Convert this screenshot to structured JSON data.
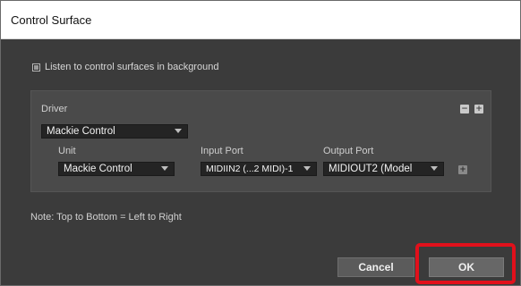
{
  "window": {
    "title": "Control Surface"
  },
  "background_option": {
    "label": "Listen to control surfaces in background",
    "checked": true
  },
  "panel": {
    "driver_label": "Driver",
    "driver_value": "Mackie Control",
    "columns": {
      "unit": "Unit",
      "input_port": "Input Port",
      "output_port": "Output Port"
    },
    "row": {
      "unit": "Mackie Control",
      "input_port": "MIDIIN2 (...2 MIDI)-1",
      "output_port": "MIDIOUT2 (Model"
    },
    "remove_symbol": "−",
    "add_symbol": "+"
  },
  "note": "Note: Top to Bottom = Left to Right",
  "buttons": {
    "cancel": "Cancel",
    "ok": "OK"
  },
  "colors": {
    "highlight": "#e1101b",
    "window_bg": "#3b3b3b",
    "panel_bg": "#4a4a4a"
  }
}
